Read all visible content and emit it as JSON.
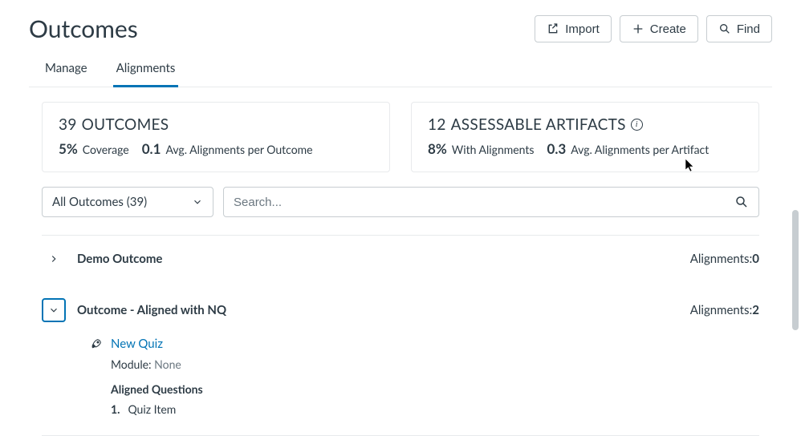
{
  "page_title": "Outcomes",
  "buttons": {
    "import": "Import",
    "create": "Create",
    "find": "Find"
  },
  "tabs": {
    "manage": "Manage",
    "alignments": "Alignments"
  },
  "cards": {
    "outcomes": {
      "count": "39",
      "label": "OUTCOMES",
      "stat1_value": "5%",
      "stat1_label": "Coverage",
      "stat2_value": "0.1",
      "stat2_label": "Avg. Alignments per Outcome"
    },
    "artifacts": {
      "count": "12",
      "label": "ASSESSABLE ARTIFACTS",
      "stat1_value": "8%",
      "stat1_label": "With Alignments",
      "stat2_value": "0.3",
      "stat2_label": "Avg. Alignments per Artifact"
    }
  },
  "filter": {
    "selected": "All Outcomes (39)"
  },
  "search": {
    "placeholder": "Search..."
  },
  "list": {
    "alignments_label": "Alignments:",
    "item1": {
      "title": "Demo Outcome",
      "count": "0"
    },
    "item2": {
      "title": "Outcome - Aligned with NQ",
      "count": "2",
      "quiz_name": "New Quiz",
      "module_label": "Module:",
      "module_value": "None",
      "aligned_title": "Aligned Questions",
      "q1_index": "1.",
      "q1_name": "Quiz Item"
    }
  }
}
